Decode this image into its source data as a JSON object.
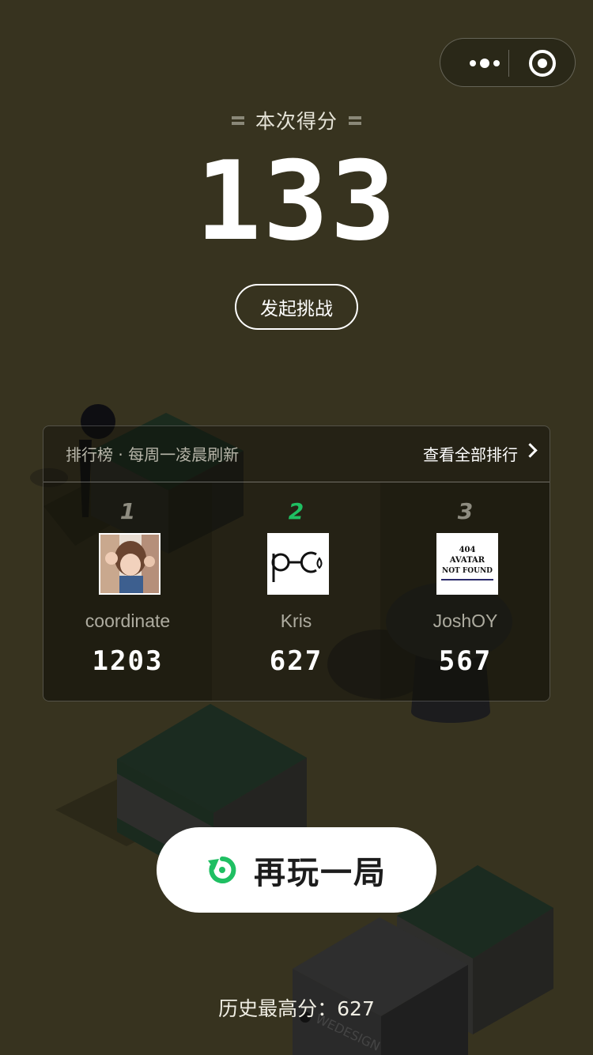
{
  "header": {
    "score_label": "本次得分",
    "score": "133",
    "challenge_label": "发起挑战"
  },
  "capsule": {
    "more_icon": "more-dots-icon",
    "close_icon": "record-target-icon"
  },
  "ranking": {
    "title": "排行榜 · 每周一凌晨刷新",
    "view_all": "查看全部排行",
    "entries": [
      {
        "rank": "1",
        "name": "coordinate",
        "score": "1203"
      },
      {
        "rank": "2",
        "name": "Kris",
        "score": "627"
      },
      {
        "rank": "3",
        "name": "JoshOY",
        "score": "567"
      }
    ],
    "avatar3_text": [
      "404",
      "AVATAR",
      "NOT FOUND"
    ]
  },
  "replay": {
    "label": "再玩一局"
  },
  "best": "历史最高分：627",
  "scene": {
    "box_label": "WEDESIGN"
  },
  "colors": {
    "background": "#37331f",
    "accent_green": "#1fbf62",
    "text_white": "#ffffff"
  }
}
